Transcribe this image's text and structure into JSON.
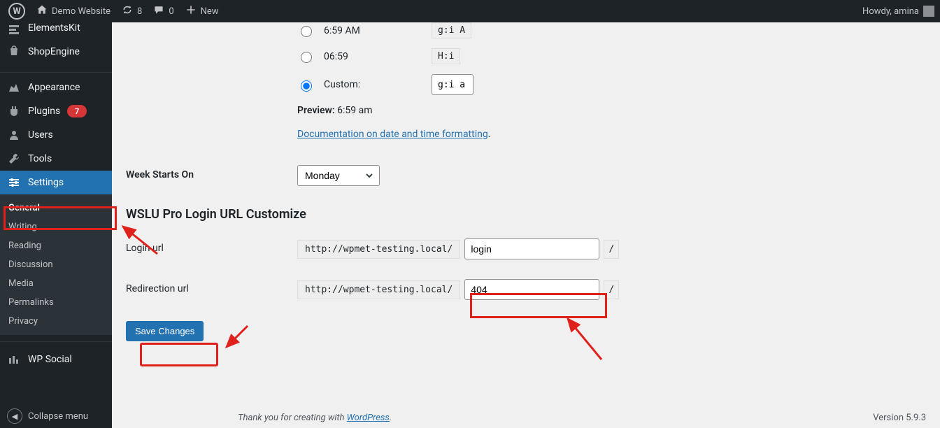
{
  "adminbar": {
    "site_name": "Demo Website",
    "updates_count": "8",
    "comments_count": "0",
    "new_label": "New",
    "howdy_prefix": "Howdy,",
    "username": "amina"
  },
  "sidebar": {
    "items": {
      "elementskit": "ElementsKit",
      "shopengine": "ShopEngine",
      "appearance": "Appearance",
      "plugins": "Plugins",
      "plugins_badge": "7",
      "users": "Users",
      "tools": "Tools",
      "settings": "Settings",
      "wpsocial": "WP Social"
    },
    "submenu": {
      "general": "General",
      "writing": "Writing",
      "reading": "Reading",
      "discussion": "Discussion",
      "media": "Media",
      "permalinks": "Permalinks",
      "privacy": "Privacy"
    },
    "collapse_label": "Collapse menu"
  },
  "time_format": {
    "opt1_label": "6:59 AM",
    "opt1_code": "g:i A",
    "opt2_label": "06:59",
    "opt2_code": "H:i",
    "opt3_label": "Custom:",
    "custom_value": "g:i a",
    "preview_label": "Preview:",
    "preview_value": "6:59 am",
    "doc_link": "Documentation on date and time formatting",
    "doc_link_suffix": "."
  },
  "week": {
    "label": "Week Starts On",
    "selected": "Monday"
  },
  "wslu": {
    "heading": "WSLU Pro Login URL Customize",
    "login_label": "Login url",
    "redirect_label": "Redirection url",
    "prefix": "http://wpmet-testing.local/",
    "suffix": "/",
    "login_value": "login",
    "redirect_value": "404"
  },
  "save_button": "Save Changes",
  "footer": {
    "thank_prefix": "Thank you for creating with ",
    "wp_link": "WordPress",
    "thank_suffix": ".",
    "version": "Version 5.9.3"
  }
}
